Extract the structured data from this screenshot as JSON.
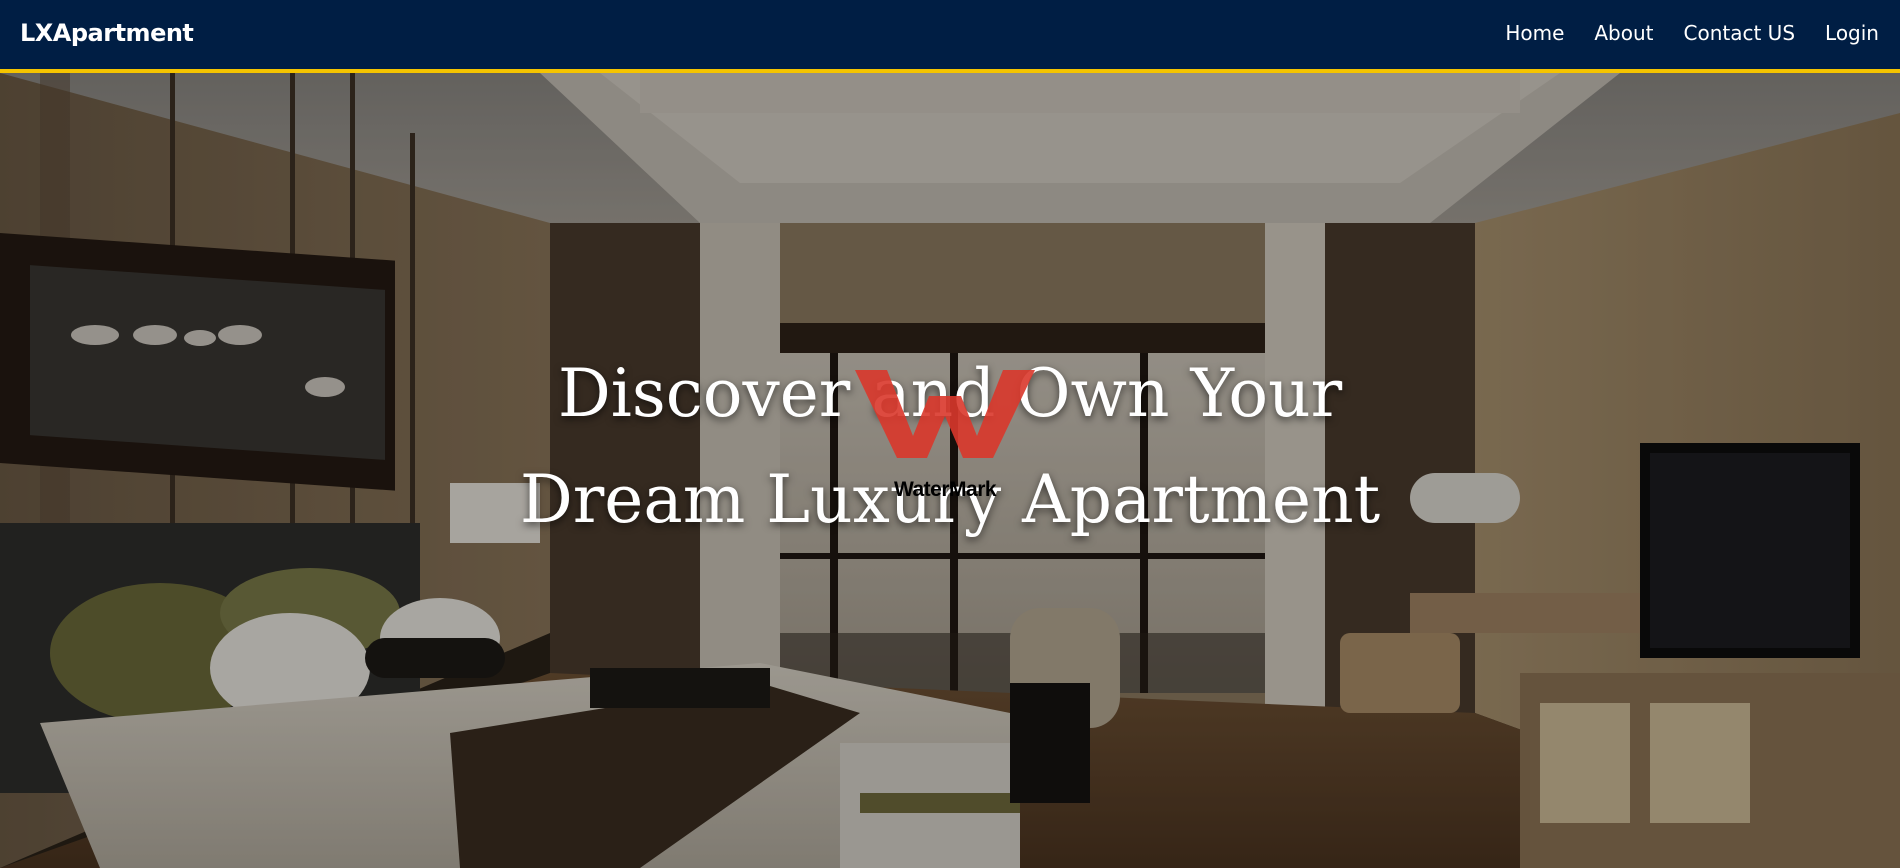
{
  "navbar": {
    "brand": "LXApartment",
    "links": [
      {
        "label": "Home"
      },
      {
        "label": "About"
      },
      {
        "label": "Contact US"
      },
      {
        "label": "Login"
      }
    ],
    "background_color": "#001e44",
    "accent_color": "#f5c400"
  },
  "hero": {
    "heading_line_1": "Discover and Own Your",
    "heading_line_2": "Dream Luxury Apartment",
    "background_image": "luxury-bedroom-interior-photo"
  },
  "watermark": {
    "text": "WaterMark",
    "color": "#d9372b"
  }
}
